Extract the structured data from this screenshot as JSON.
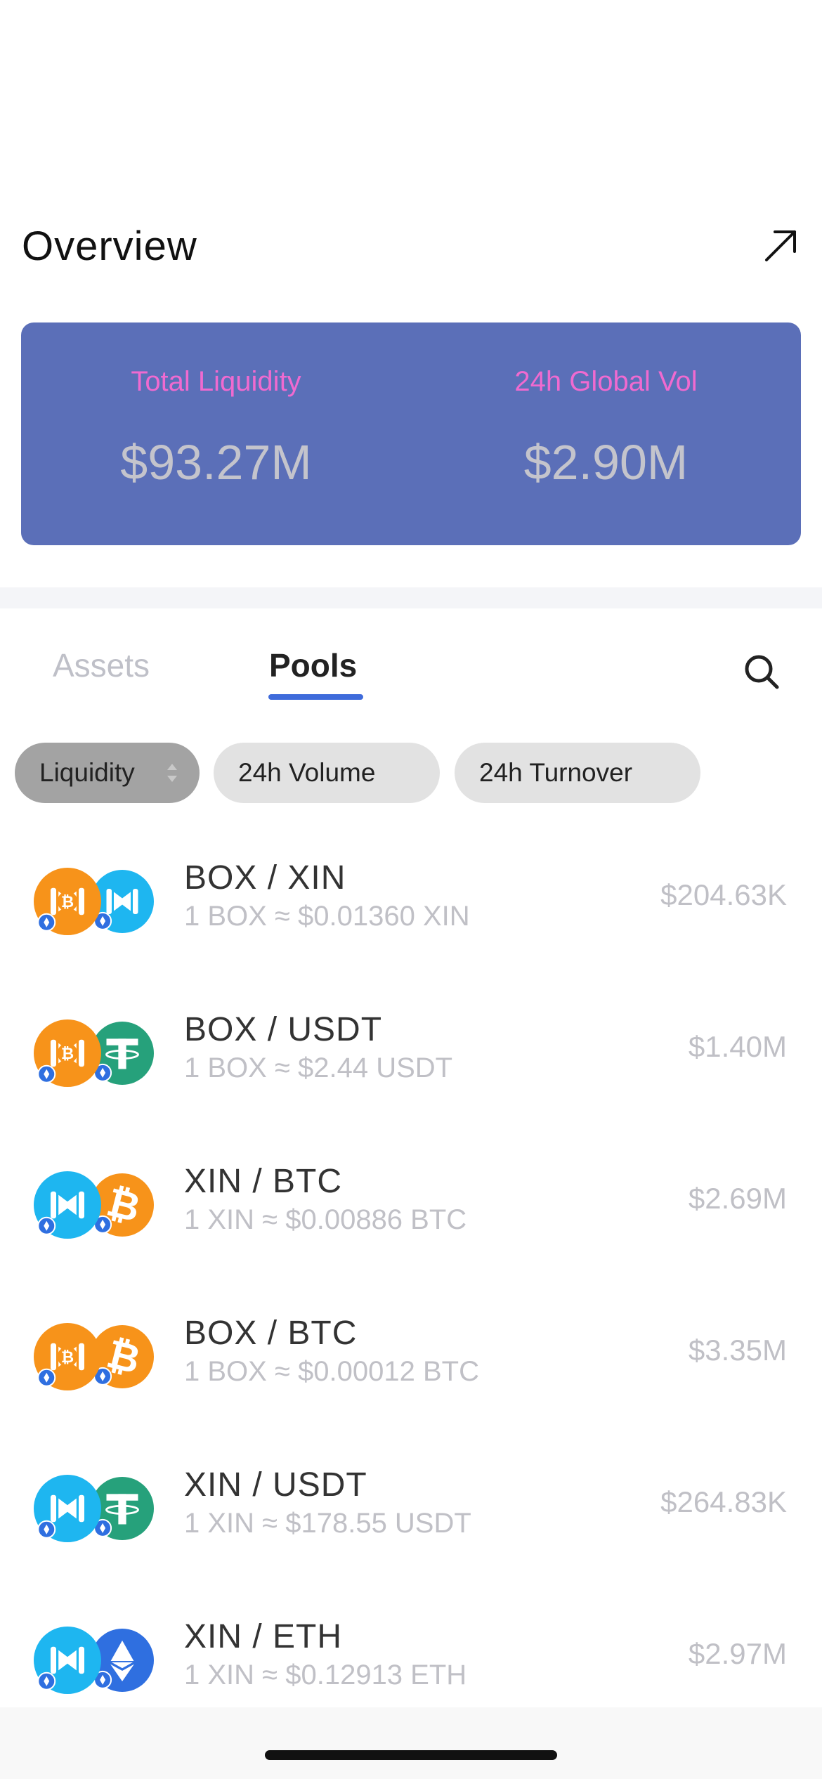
{
  "overview": {
    "title": "Overview",
    "link_icon": "arrow-up-right-icon"
  },
  "stats": {
    "total_liquidity_label": "Total Liquidity",
    "total_liquidity_value": "$93.27M",
    "global_vol_label": "24h Global Vol",
    "global_vol_value": "$2.90M"
  },
  "tabs": {
    "assets_label": "Assets",
    "pools_label": "Pools",
    "active": "Pools",
    "search_icon": "search-icon"
  },
  "filters": {
    "liquidity_label": "Liquidity",
    "volume_label": "24h Volume",
    "turnover_label": "24h Turnover",
    "selected": "Liquidity"
  },
  "pools": [
    {
      "name": "BOX / XIN",
      "rate": "1 BOX ≈ $0.01360 XIN",
      "value": "$204.63K",
      "icon_a": "box",
      "icon_b": "xin"
    },
    {
      "name": "BOX / USDT",
      "rate": "1 BOX ≈ $2.44 USDT",
      "value": "$1.40M",
      "icon_a": "box",
      "icon_b": "usdt"
    },
    {
      "name": "XIN / BTC",
      "rate": "1 XIN ≈ $0.00886 BTC",
      "value": "$2.69M",
      "icon_a": "xin",
      "icon_b": "btc"
    },
    {
      "name": "BOX / BTC",
      "rate": "1 BOX ≈ $0.00012 BTC",
      "value": "$3.35M",
      "icon_a": "box",
      "icon_b": "btc"
    },
    {
      "name": "XIN / USDT",
      "rate": "1 XIN ≈ $178.55 USDT",
      "value": "$264.83K",
      "icon_a": "xin",
      "icon_b": "usdt"
    },
    {
      "name": "XIN / ETH",
      "rate": "1 XIN ≈ $0.12913 ETH",
      "value": "$2.97M",
      "icon_a": "xin",
      "icon_b": "eth"
    }
  ],
  "colors": {
    "card_bg": "#5b6fb8",
    "card_label": "#f06ad0",
    "accent": "#3f6bdb",
    "box": "#f7931a",
    "xin": "#1eb6f0",
    "usdt": "#26a17b",
    "btc": "#f7931a",
    "eth": "#2f6fe0"
  }
}
